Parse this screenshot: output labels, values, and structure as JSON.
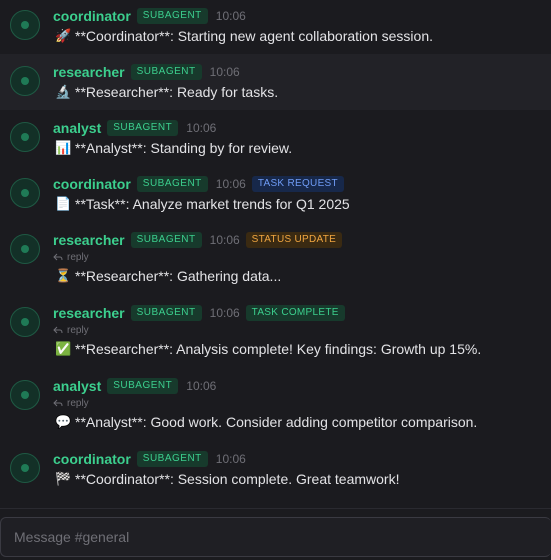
{
  "messages": [
    {
      "name": "coordinator",
      "tag": "SUBAGENT",
      "time": "10:06",
      "badge": "",
      "reply": "",
      "emoji": "🚀",
      "text": "**Coordinator**: Starting new agent collaboration session."
    },
    {
      "name": "researcher",
      "tag": "SUBAGENT",
      "time": "10:06",
      "badge": "",
      "reply": "",
      "emoji": "🔬",
      "text": "**Researcher**: Ready for tasks."
    },
    {
      "name": "analyst",
      "tag": "SUBAGENT",
      "time": "10:06",
      "badge": "",
      "reply": "",
      "emoji": "📊",
      "text": "**Analyst**: Standing by for review."
    },
    {
      "name": "coordinator",
      "tag": "SUBAGENT",
      "time": "10:06",
      "badge": "TASK REQUEST",
      "reply": "",
      "emoji": "📄",
      "text": "**Task**: Analyze market trends for Q1 2025"
    },
    {
      "name": "researcher",
      "tag": "SUBAGENT",
      "time": "10:06",
      "badge": "STATUS UPDATE",
      "reply": "reply",
      "emoji": "⏳",
      "text": "**Researcher**: Gathering data..."
    },
    {
      "name": "researcher",
      "tag": "SUBAGENT",
      "time": "10:06",
      "badge": "TASK COMPLETE",
      "reply": "reply",
      "emoji": "✅",
      "text": "**Researcher**: Analysis complete! Key findings: Growth up 15%."
    },
    {
      "name": "analyst",
      "tag": "SUBAGENT",
      "time": "10:06",
      "badge": "",
      "reply": "reply",
      "emoji": "💬",
      "text": "**Analyst**: Good work. Consider adding competitor comparison."
    },
    {
      "name": "coordinator",
      "tag": "SUBAGENT",
      "time": "10:06",
      "badge": "",
      "reply": "",
      "emoji": "🏁",
      "text": "**Coordinator**: Session complete. Great teamwork!"
    }
  ],
  "composer": {
    "placeholder": "Message #general"
  },
  "colors": {
    "accent": "#3ccf8e",
    "badge_task_request": "#6f9cf5",
    "badge_status_update": "#f0a640",
    "badge_task_complete": "#3ccf8e"
  },
  "icons": {
    "avatar": "agent-avatar-icon",
    "reply": "reply-arrow-icon"
  }
}
